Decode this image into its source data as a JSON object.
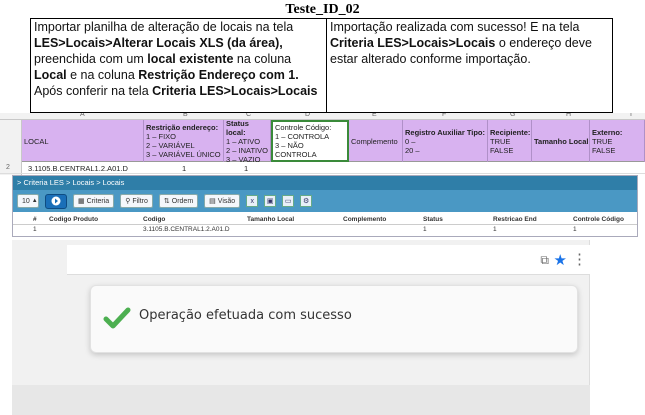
{
  "doc": {
    "title": "Teste_ID_02",
    "instruction_left": [
      [
        "Importar planilha de alteração de locais na tela"
      ],
      [
        "LES>Locais>Alterar Locais XLS (da área),",
        "bold"
      ],
      [
        "preenchida com um ",
        "",
        "local existente",
        " na coluna"
      ],
      [
        "Local",
        " e na coluna ",
        "Restrição Endereço com 1."
      ],
      [
        "Após conferir na tela ",
        "Criteria LES>Locais>Locais"
      ]
    ],
    "instruction_right": {
      "line1": "Importação realizada com sucesso! E na tela",
      "bold": "Criteria LES>Locais>Locais",
      "line2_rest": " o endereço deve",
      "line3": "estar alterado conforme importação."
    }
  },
  "sheet": {
    "col_letters": [
      "A",
      "B",
      "C",
      "D",
      "E",
      "F",
      "G",
      "H",
      "I"
    ],
    "headers": {
      "local": "LOCAL",
      "restricao": [
        "Restrição endereço:",
        "1 – FIXO",
        "2 – VARIÁVEL",
        "3 – VARIÁVEL ÚNICO"
      ],
      "status": [
        "Status local:",
        "1 – ATIVO",
        "2 – INATIVO",
        "3 – VAZIO"
      ],
      "controle": [
        "Controle Código:",
        "1 – CONTROLA",
        "3 – NÃO CONTROLA"
      ],
      "complemento": "Complemento",
      "registro": [
        "Registro Auxiliar Tipo:",
        "0 –",
        "20 –"
      ],
      "recipiente": [
        "Recipiente:",
        "TRUE",
        "FALSE"
      ],
      "tamanho": "Tamanho Local",
      "externo": [
        "Externo:",
        "TRUE",
        "FALSE"
      ]
    },
    "row_number": "2",
    "row": {
      "local": "3.1105.B.CENTRAL1.2.A01.D",
      "restricao": "1",
      "status": "1"
    }
  },
  "app": {
    "breadcrumb": "> Criteria LES > Locais > Locais",
    "page_size": "10",
    "buttons": {
      "criteria": "Criteria",
      "filtro": "Filtro",
      "ordem": "Ordem",
      "visao": "Visão"
    },
    "grid_headers": [
      "#",
      "Codigo Produto",
      "Codigo",
      "Tamanho Local",
      "Complemento",
      "Status",
      "Restricao End",
      "Controle Código"
    ],
    "grid_row": [
      "1",
      "",
      "3.1105.B.CENTRAL1.2.A01.D",
      "",
      "",
      "1",
      "1",
      "1"
    ]
  },
  "browser": {
    "toast_message": "Operação efetuada com sucesso",
    "accent": "#1a73e8",
    "check_color": "#4caf50"
  }
}
